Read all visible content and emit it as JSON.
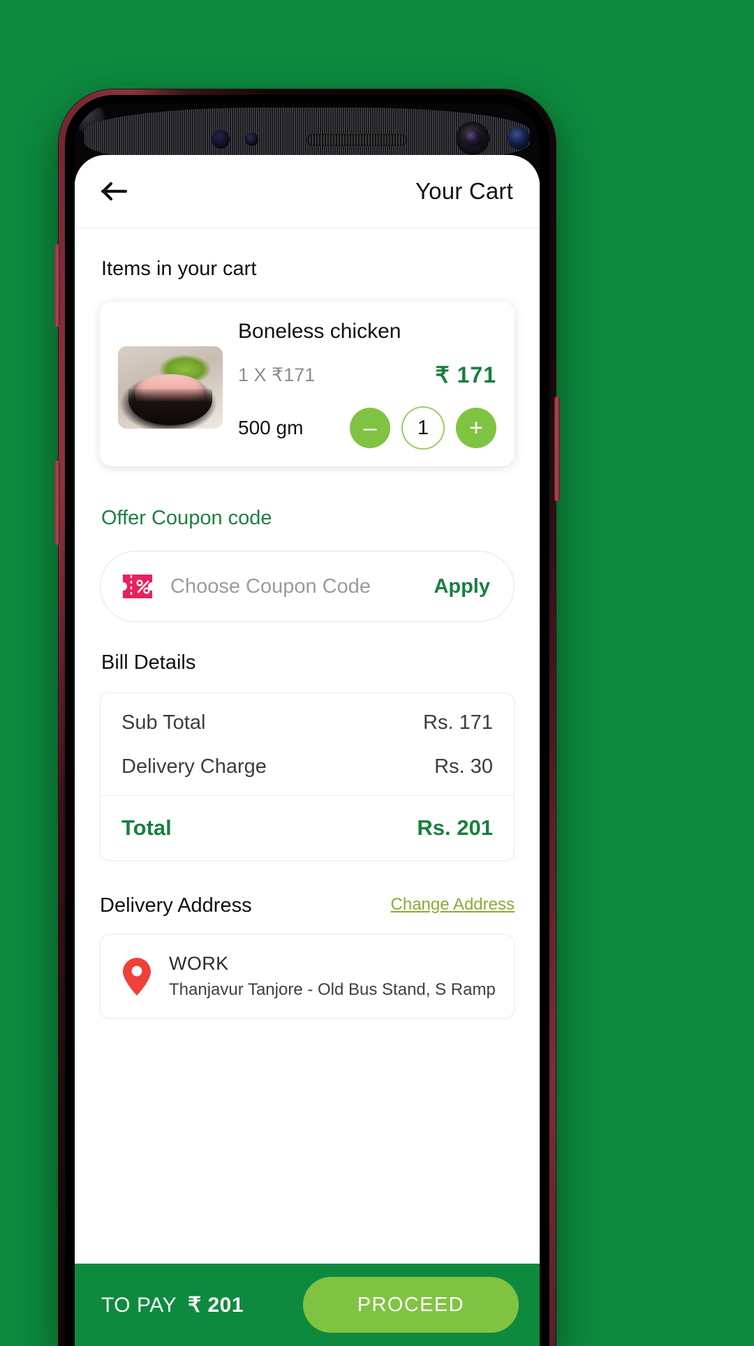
{
  "theme": {
    "page_background": "#0d8a3e",
    "brand_green": "#17803f",
    "accent_light_green": "#80c342",
    "coupon_icon_color": "#e8days",
    "coupon_pink": "#e8215c",
    "pin_red": "#f0403a",
    "link_olive": "#8aab36"
  },
  "header": {
    "back_icon": "arrow-left-icon",
    "title": "Your Cart"
  },
  "cart": {
    "section_title": "Items in your cart",
    "item": {
      "image_alt": "boneless-chicken-bowl",
      "name": "Boneless chicken",
      "unit_line": "1 X ₹171",
      "price": "₹ 171",
      "weight": "500 gm",
      "decrement_label": "–",
      "quantity": "1",
      "increment_label": "+"
    }
  },
  "coupon": {
    "section_title": "Offer Coupon code",
    "icon": "coupon-percent-icon",
    "placeholder": "Choose Coupon Code",
    "apply_label": "Apply"
  },
  "bill": {
    "section_title": "Bill Details",
    "rows": [
      {
        "label": "Sub Total",
        "value": "Rs. 171"
      },
      {
        "label": "Delivery Charge",
        "value": "Rs. 30"
      }
    ],
    "total": {
      "label": "Total",
      "value": "Rs. 201"
    }
  },
  "address": {
    "section_title": "Delivery Address",
    "change_label": "Change Address",
    "pin_icon": "location-pin-icon",
    "type": "WORK",
    "line": "Thanjavur Tanjore - Old Bus Stand, S Rampart Rd,"
  },
  "footer": {
    "to_pay_label": "TO PAY",
    "to_pay_amount": "₹ 201",
    "proceed_label": "PROCEED"
  }
}
